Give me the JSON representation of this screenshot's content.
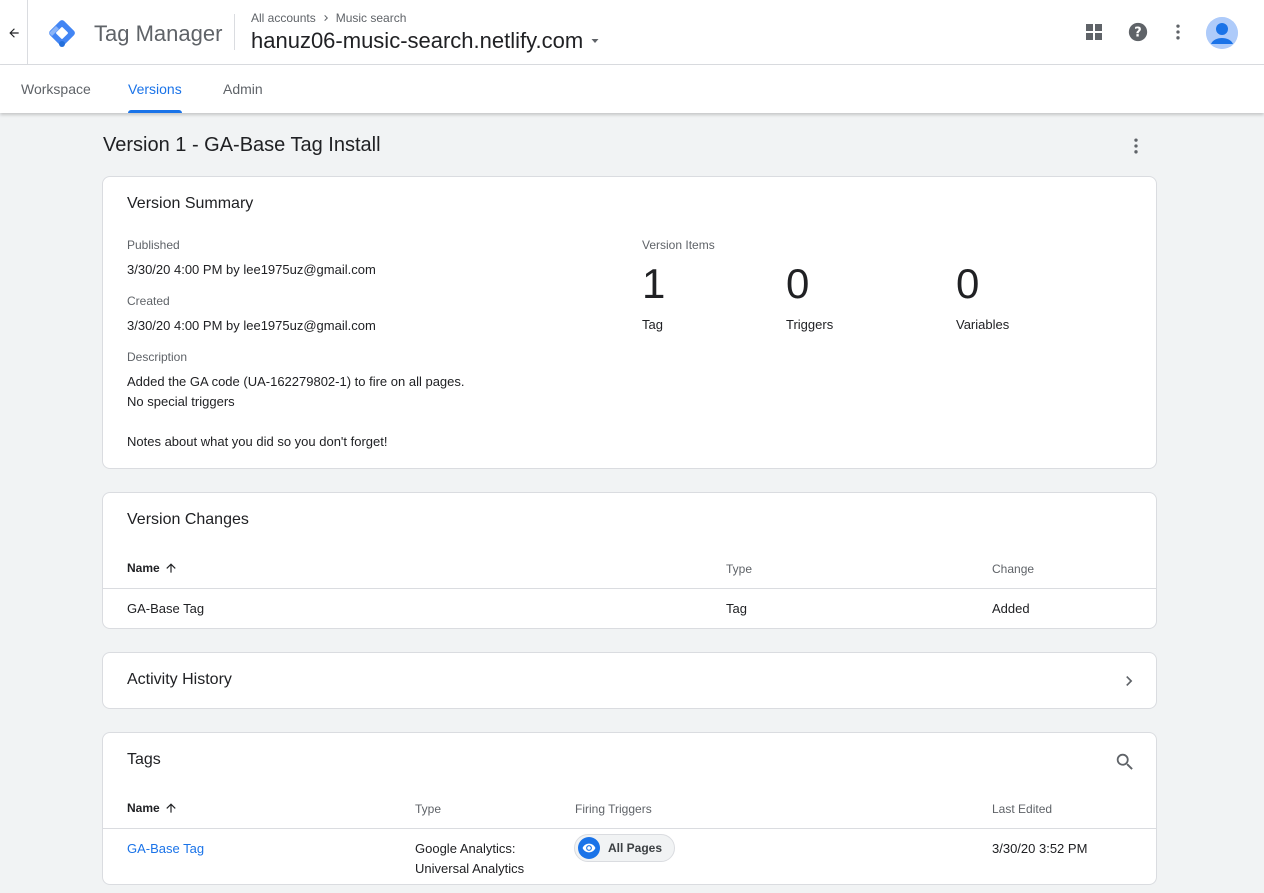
{
  "header": {
    "product_name": "Tag Manager",
    "breadcrumb": {
      "account": "All accounts",
      "separator": ">",
      "current": "Music search"
    },
    "container_name": "hanuz06-music-search.netlify.com"
  },
  "tabs": [
    {
      "label": "Workspace",
      "active": false
    },
    {
      "label": "Versions",
      "active": true
    },
    {
      "label": "Admin",
      "active": false
    }
  ],
  "page": {
    "title": "Version 1 - GA-Base Tag Install"
  },
  "summary": {
    "title": "Version Summary",
    "published_label": "Published",
    "published_value": "3/30/20 4:00 PM by lee1975uz@gmail.com",
    "created_label": "Created",
    "created_value": "3/30/20 4:00 PM by lee1975uz@gmail.com",
    "description_label": "Description",
    "description_line1": "Added the GA code  (UA-162279802-1) to fire on all pages.",
    "description_line2": "No special triggers",
    "description_line3": "Notes about what you did so you don't forget!",
    "items_label": "Version Items",
    "items": [
      {
        "count": "1",
        "label": "Tag"
      },
      {
        "count": "0",
        "label": "Triggers"
      },
      {
        "count": "0",
        "label": "Variables"
      }
    ]
  },
  "changes": {
    "title": "Version Changes",
    "columns": {
      "name": "Name",
      "type": "Type",
      "change": "Change"
    },
    "rows": [
      {
        "name": "GA-Base Tag",
        "type": "Tag",
        "change": "Added"
      }
    ]
  },
  "activity": {
    "title": "Activity History"
  },
  "tags": {
    "title": "Tags",
    "columns": {
      "name": "Name",
      "type": "Type",
      "triggers": "Firing Triggers",
      "last_edited": "Last Edited"
    },
    "rows": [
      {
        "name": "GA-Base Tag",
        "type_line1": "Google Analytics:",
        "type_line2": "Universal Analytics",
        "trigger": "All Pages",
        "last_edited": "3/30/20 3:52 PM"
      }
    ]
  },
  "colors": {
    "accent": "#1a73e8",
    "background": "#f1f3f4",
    "border": "#dadce0"
  }
}
